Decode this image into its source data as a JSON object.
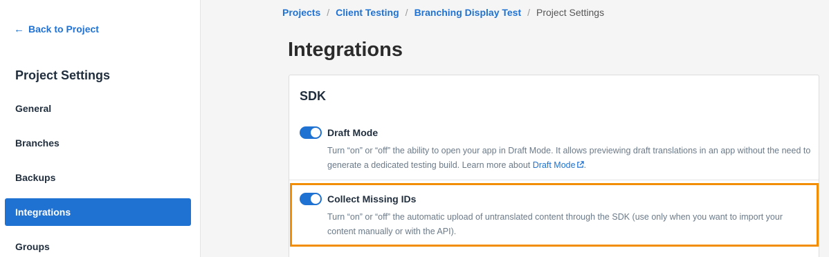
{
  "sidebar": {
    "back_label": "Back to Project",
    "heading": "Project Settings",
    "items": [
      {
        "label": "General"
      },
      {
        "label": "Branches"
      },
      {
        "label": "Backups"
      },
      {
        "label": "Integrations",
        "active": true
      },
      {
        "label": "Groups"
      }
    ]
  },
  "breadcrumb": {
    "items": [
      "Projects",
      "Client Testing",
      "Branching Display Test"
    ],
    "current": "Project Settings",
    "separator": "/"
  },
  "page": {
    "title": "Integrations"
  },
  "sdk_card": {
    "title": "SDK",
    "draft_mode": {
      "title": "Draft Mode",
      "enabled": true,
      "desc_before_link": "Turn “on” or “off” the ability to open your app in Draft Mode. It allows previewing draft translations in an app without the need to generate a dedicated testing build. Learn more about ",
      "link_text": "Draft Mode",
      "desc_after_link": "."
    },
    "collect_missing_ids": {
      "title": "Collect Missing IDs",
      "enabled": true,
      "desc": "Turn “on” or “off” the automatic upload of untranslated content through the SDK (use only when you want to import your content manually or with the API)."
    }
  },
  "colors": {
    "accent": "#1f72d1",
    "highlight": "#f28c00"
  },
  "icons": {
    "back": "arrow-left-icon",
    "external": "external-link-icon"
  }
}
